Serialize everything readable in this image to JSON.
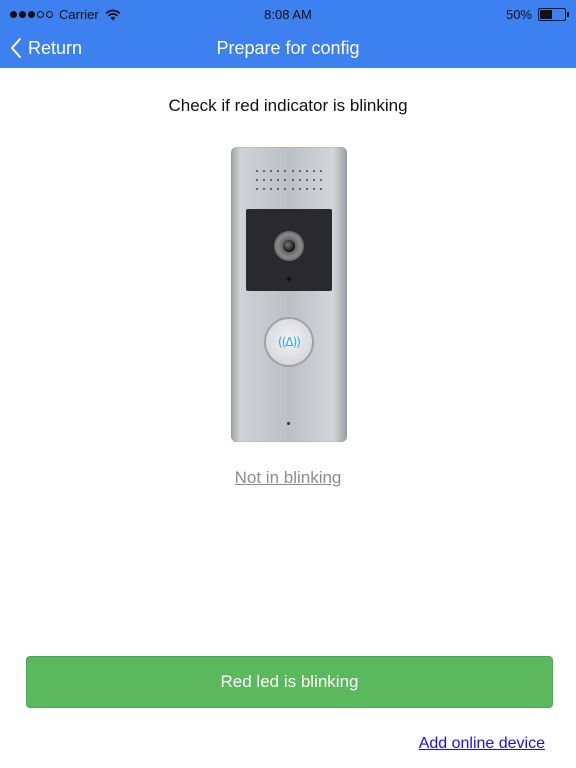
{
  "status_bar": {
    "carrier": "Carrier",
    "time": "8:08 AM",
    "battery_text": "50%",
    "battery_level": 0.5,
    "signal_bars_filled": 3,
    "signal_bars_total": 5
  },
  "nav": {
    "back_label": "Return",
    "title": "Prepare for config"
  },
  "main": {
    "heading": "Check if red indicator is blinking",
    "not_blinking_link": "Not in blinking"
  },
  "actions": {
    "primary_button": "Red led is blinking",
    "add_online_link": "Add online device"
  },
  "icons": {
    "back": "chevron-left-icon",
    "wifi": "wifi-icon",
    "battery": "battery-icon",
    "bell": "bell-icon"
  },
  "colors": {
    "nav_bar": "#3d80f0",
    "primary_button": "#5cb85c",
    "link_blue": "#1a0dff",
    "link_gray": "#8e8e8e"
  }
}
